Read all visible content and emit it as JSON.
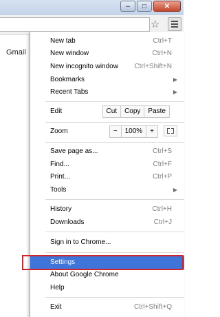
{
  "window": {
    "minimize_icon": "minimize-icon",
    "maximize_icon": "maximize-icon",
    "close_icon": "close-icon"
  },
  "toolbar": {
    "bookmark_icon": "star-icon",
    "menu_icon": "hamburger-menu-icon"
  },
  "page": {
    "gmail_link": "Gmail"
  },
  "menu": {
    "new_tab": {
      "label": "New tab",
      "shortcut": "Ctrl+T"
    },
    "new_window": {
      "label": "New window",
      "shortcut": "Ctrl+N"
    },
    "new_incognito": {
      "label": "New incognito window",
      "shortcut": "Ctrl+Shift+N"
    },
    "bookmarks": {
      "label": "Bookmarks"
    },
    "recent_tabs": {
      "label": "Recent Tabs"
    },
    "edit": {
      "label": "Edit",
      "cut": "Cut",
      "copy": "Copy",
      "paste": "Paste"
    },
    "zoom": {
      "label": "Zoom",
      "minus": "−",
      "level": "100%",
      "plus": "+"
    },
    "save_page": {
      "label": "Save page as...",
      "shortcut": "Ctrl+S"
    },
    "find": {
      "label": "Find...",
      "shortcut": "Ctrl+F"
    },
    "print": {
      "label": "Print...",
      "shortcut": "Ctrl+P"
    },
    "tools": {
      "label": "Tools"
    },
    "history": {
      "label": "History",
      "shortcut": "Ctrl+H"
    },
    "downloads": {
      "label": "Downloads",
      "shortcut": "Ctrl+J"
    },
    "sign_in": {
      "label": "Sign in to Chrome..."
    },
    "settings": {
      "label": "Settings"
    },
    "about": {
      "label": "About Google Chrome"
    },
    "help": {
      "label": "Help"
    },
    "exit": {
      "label": "Exit",
      "shortcut": "Ctrl+Shift+Q"
    }
  },
  "colors": {
    "highlight": "#3f74d8",
    "annotation_box": "#d2232a"
  }
}
